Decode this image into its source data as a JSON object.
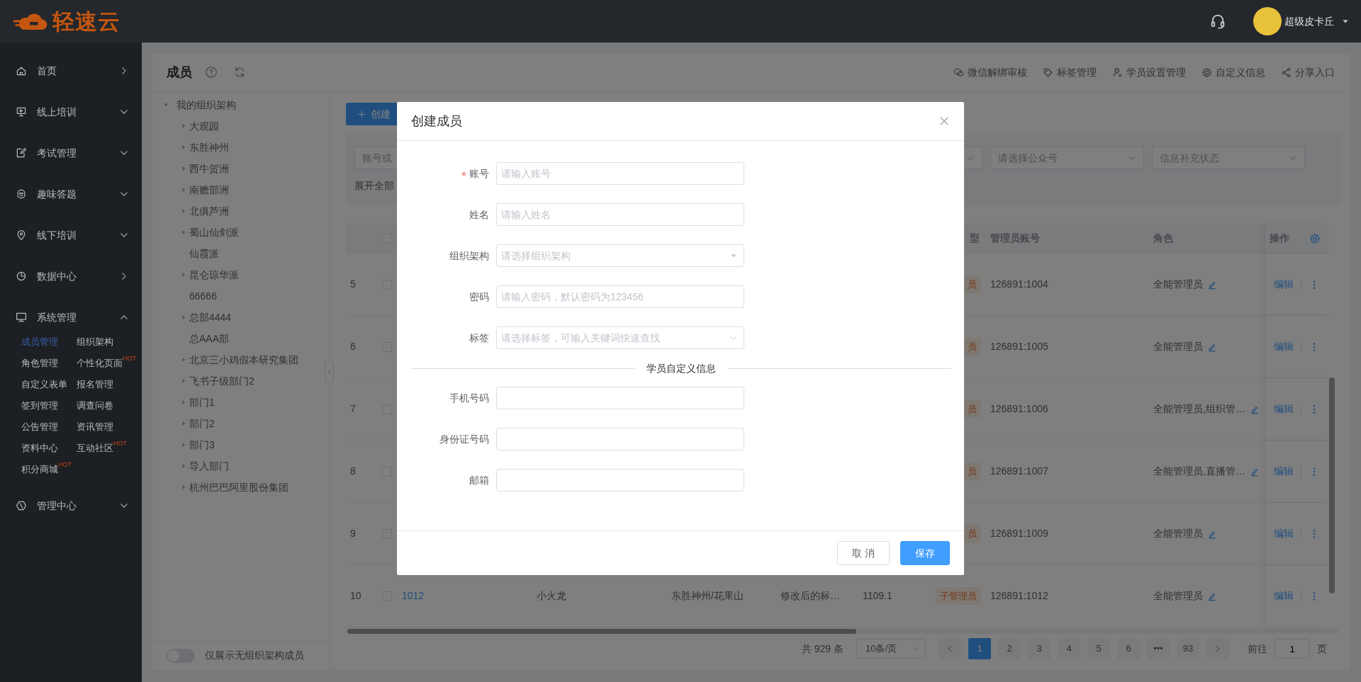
{
  "header": {
    "logo_text": "轻速云",
    "user_name": "超级皮卡丘"
  },
  "sidebar": {
    "items": [
      {
        "label": "首页",
        "kind": "link"
      },
      {
        "label": "线上培训",
        "kind": "menu",
        "expanded": false
      },
      {
        "label": "考试管理",
        "kind": "menu",
        "expanded": false
      },
      {
        "label": "趣味答题",
        "kind": "menu",
        "expanded": false
      },
      {
        "label": "线下培训",
        "kind": "menu",
        "expanded": false
      },
      {
        "label": "数据中心",
        "kind": "link"
      },
      {
        "label": "系统管理",
        "kind": "menu",
        "expanded": true,
        "children": [
          {
            "label": "成员管理",
            "selected": true
          },
          {
            "label": "组织架构",
            "selected": false
          },
          {
            "label": "角色管理",
            "selected": false
          },
          {
            "label": "个性化页面",
            "selected": false,
            "badge": "HOT"
          },
          {
            "label": "自定义表单",
            "selected": false
          },
          {
            "label": "报名管理",
            "selected": false
          },
          {
            "label": "签到管理",
            "selected": false
          },
          {
            "label": "调查问卷",
            "selected": false
          },
          {
            "label": "公告管理",
            "selected": false
          },
          {
            "label": "资讯管理",
            "selected": false
          },
          {
            "label": "资料中心",
            "selected": false
          },
          {
            "label": "互动社区",
            "selected": false,
            "badge": "HOT"
          },
          {
            "label": "积分商城",
            "selected": false,
            "badge": "HOT"
          }
        ]
      },
      {
        "label": "管理中心",
        "kind": "menu",
        "expanded": false
      }
    ]
  },
  "page": {
    "title": "成员",
    "toolbar": [
      "微信解绑审核",
      "标签管理",
      "学员设置管理",
      "自定义信息",
      "分享入口"
    ]
  },
  "org_tree": {
    "root": {
      "label": "我的组织架构",
      "expanded": true,
      "children": [
        {
          "label": "大观园",
          "expandable": true
        },
        {
          "label": "东胜神州",
          "expandable": true
        },
        {
          "label": "西牛贺洲",
          "expandable": true
        },
        {
          "label": "南赡部洲",
          "expandable": true
        },
        {
          "label": "北俱芦洲",
          "expandable": true
        },
        {
          "label": "蜀山仙剑派",
          "expandable": true
        },
        {
          "label": "仙霞派",
          "expandable": false
        },
        {
          "label": "昆仑琼华派",
          "expandable": true
        },
        {
          "label": "66666",
          "expandable": false
        },
        {
          "label": "总部4444",
          "expandable": true
        },
        {
          "label": "总AAA部",
          "expandable": false
        },
        {
          "label": "北京三小鸡假本研究集团",
          "expandable": true
        },
        {
          "label": "飞书子级部门2",
          "expandable": true
        },
        {
          "label": "部门1",
          "expandable": true
        },
        {
          "label": "部门2",
          "expandable": true
        },
        {
          "label": "部门3",
          "expandable": true
        },
        {
          "label": "导入部门",
          "expandable": true
        },
        {
          "label": "杭州巴巴阿里股份集团",
          "expandable": true
        }
      ]
    },
    "toggle": {
      "label": "仅展示无组织架构成员",
      "on": false
    }
  },
  "members": {
    "create_button": "创建",
    "filters": {
      "search_placeholder": "账号或",
      "selects": [
        {
          "kind": "select"
        },
        {
          "kind": "select",
          "placeholder": "请选择公众号"
        },
        {
          "kind": "select",
          "placeholder": "信息补充状态"
        }
      ],
      "expand_all": "展开全部"
    },
    "table": {
      "columns": {
        "type": "型",
        "admin_account": "管理员账号",
        "role": "角色",
        "actions": "操作"
      },
      "header_checked": false,
      "rows": [
        {
          "index": "5",
          "checked": false,
          "type": "员",
          "admin_account": "126891:1004",
          "role": "全能管理员",
          "action": "编辑"
        },
        {
          "index": "6",
          "checked": false,
          "type": "员",
          "admin_account": "126891:1005",
          "role": "全能管理员",
          "action": "编辑"
        },
        {
          "index": "7",
          "checked": false,
          "type": "员",
          "admin_account": "126891:1006",
          "role": "全能管理员,组织管…",
          "action": "编辑"
        },
        {
          "index": "8",
          "checked": false,
          "type": "员",
          "admin_account": "126891:1007",
          "role": "全能管理员,直播管…",
          "action": "编辑"
        },
        {
          "index": "9",
          "checked": false,
          "type": "员",
          "admin_account": "126891:1009",
          "role": "全能管理员",
          "action": "编辑"
        },
        {
          "index": "10",
          "checked": false,
          "account": "1012",
          "name": "小火龙",
          "org": "东胜神州/花果山",
          "tags": "修改后的标…",
          "column_7": "1109.1",
          "type": "子管理员",
          "admin_account": "126891:1012",
          "role": "全能管理员",
          "action": "编辑"
        }
      ]
    },
    "pagination": {
      "total": "共 929 条",
      "page_size": "10条/页",
      "pages": [
        {
          "label": "1",
          "selected": true
        },
        {
          "label": "2",
          "selected": false
        },
        {
          "label": "3",
          "selected": false
        },
        {
          "label": "4",
          "selected": false
        },
        {
          "label": "5",
          "selected": false
        },
        {
          "label": "6",
          "selected": false
        },
        {
          "label": "•••",
          "selected": false
        },
        {
          "label": "93",
          "selected": false
        }
      ],
      "goto_label": "前往",
      "goto_value": "1",
      "goto_suffix": "页"
    }
  },
  "dialog": {
    "title": "创建成员",
    "fields": [
      {
        "label": "账号",
        "required": true,
        "kind": "text",
        "placeholder": "请输入账号"
      },
      {
        "label": "姓名",
        "required": false,
        "kind": "text",
        "placeholder": "请输入姓名"
      },
      {
        "label": "组织架构",
        "required": false,
        "kind": "select",
        "placeholder": "请选择组织架构"
      },
      {
        "label": "密码",
        "required": false,
        "kind": "text",
        "placeholder": "请输入密码，默认密码为123456"
      },
      {
        "label": "标签",
        "required": false,
        "kind": "tags",
        "placeholder": "请选择标签，可输入关键词快速查找"
      }
    ],
    "section_title": "学员自定义信息",
    "custom_fields": [
      {
        "label": "手机号码",
        "kind": "text"
      },
      {
        "label": "身份证号码",
        "kind": "text"
      },
      {
        "label": "邮箱",
        "kind": "text"
      }
    ],
    "buttons": [
      {
        "label": "取 消",
        "kind": "default"
      },
      {
        "label": "保存",
        "kind": "primary"
      }
    ]
  }
}
